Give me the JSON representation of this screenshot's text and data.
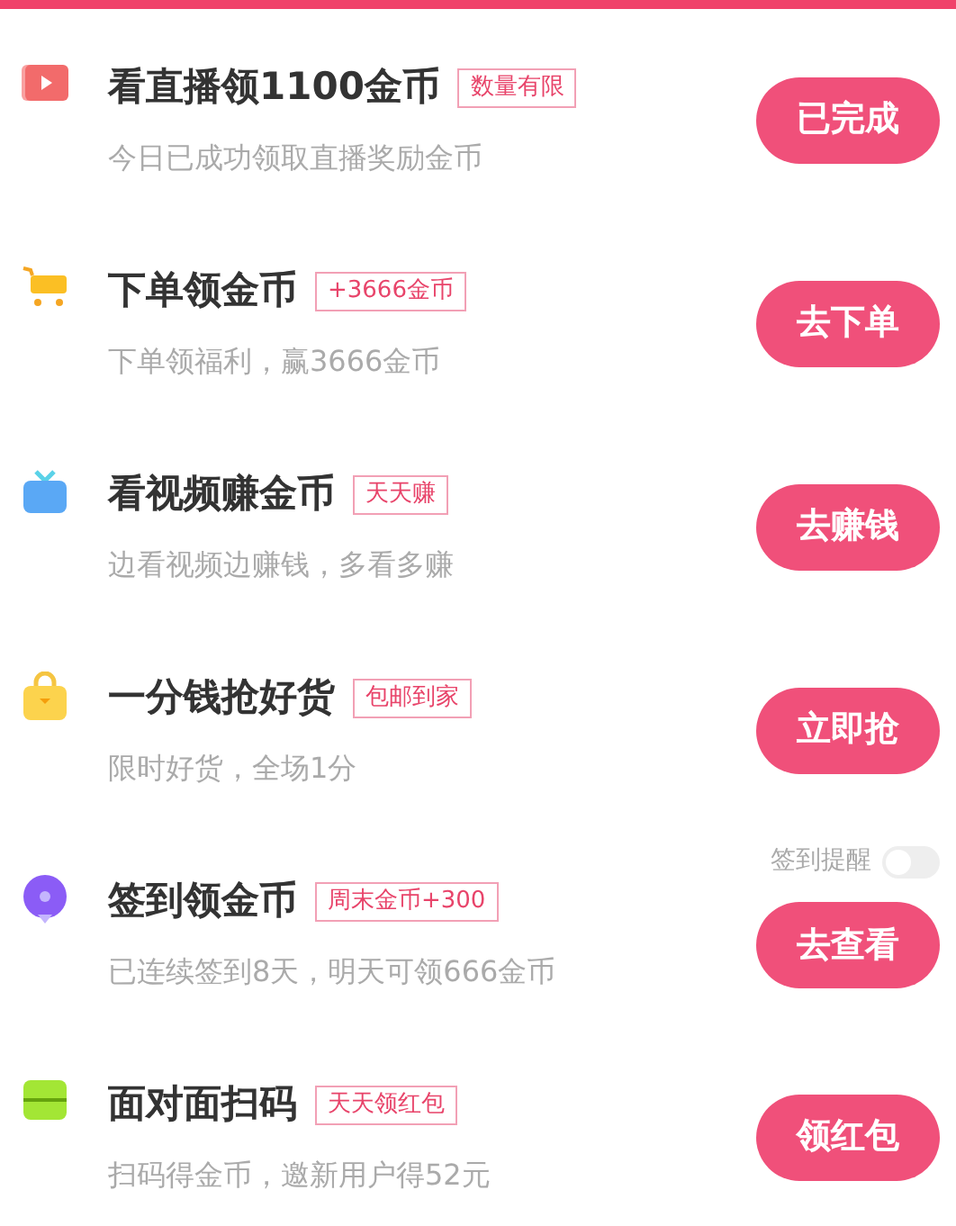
{
  "tasks": [
    {
      "title": "看直播领1100金币",
      "tag": "数量有限",
      "subtitle": "今日已成功领取直播奖励金币",
      "button": "已完成"
    },
    {
      "title": "下单领金币",
      "tag": "+3666金币",
      "subtitle": "下单领福利，赢3666金币",
      "button": "去下单"
    },
    {
      "title": "看视频赚金币",
      "tag": "天天赚",
      "subtitle": "边看视频边赚钱，多看多赚",
      "button": "去赚钱"
    },
    {
      "title": "一分钱抢好货",
      "tag": "包邮到家",
      "subtitle": "限时好货，全场1分",
      "button": "立即抢"
    },
    {
      "title": "签到领金币",
      "tag": "周末金币+300",
      "subtitle": "已连续签到8天，明天可领666金币",
      "button": "去查看",
      "reminder": {
        "label": "签到提醒",
        "on": false
      }
    },
    {
      "title": "面对面扫码",
      "tag": "天天领红包",
      "subtitle": "扫码得金币，邀新用户得52元",
      "button": "领红包"
    }
  ]
}
